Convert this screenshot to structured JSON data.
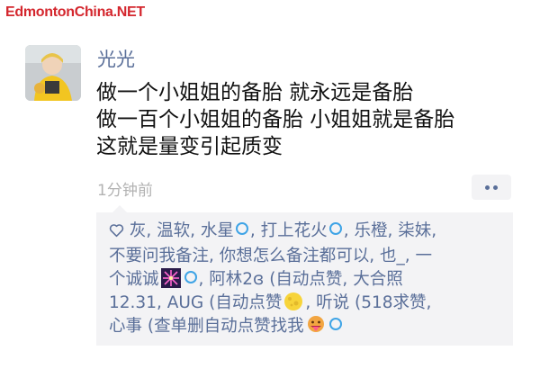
{
  "watermark": "EdmontonChina.NET",
  "post": {
    "username": "光光",
    "lines": [
      "做一个小姐姐的备胎 就永远是备胎",
      "做一百个小姐姐的备胎 小姐姐就是备胎",
      "这就是量变引起质变"
    ],
    "timestamp": "1分钟前"
  },
  "likes": {
    "icon": "heart-outline-icon",
    "line1": "灰, 温软, 水星",
    "line1b": ", 打上花火",
    "line1c": ", 乐橙, 柒妹,",
    "line2": "不要问我备注, 你想怎么备注都可以, 也_, 一",
    "line3a": "个诚诚",
    "line3b": ", 阿林2ɞ (自动点赞, 大合照",
    "line4a": "12.31, AUG (自动点赞",
    "line4b": ", 听说 (518求赞,",
    "line5a": "心事 (查单删自动点赞找我",
    "emojis": [
      "fireworks-icon",
      "full-moon-icon",
      "tongue-face-icon"
    ],
    "colors": {
      "accent": "#5a6f99",
      "ring": "#3fa4e6",
      "watermark": "#d4272e"
    }
  }
}
